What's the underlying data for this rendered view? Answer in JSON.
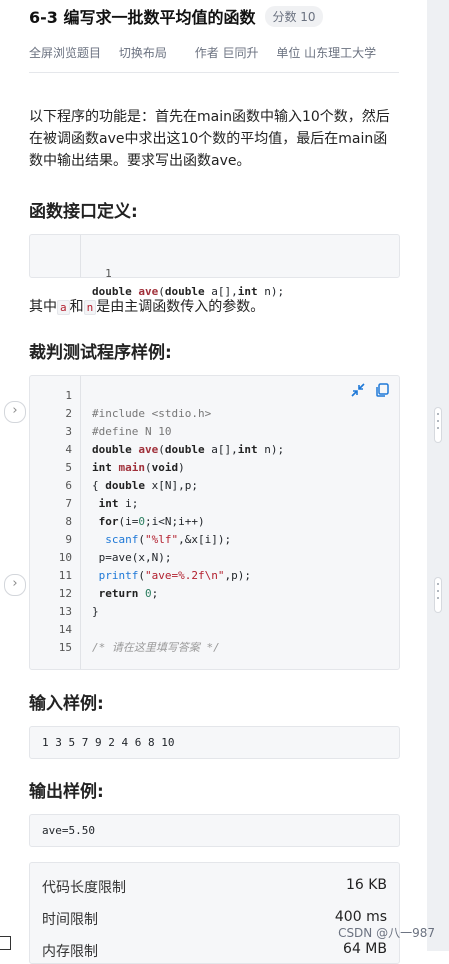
{
  "problem": {
    "title": "6-3 编写求一批数平均值的函数",
    "score_badge": "分数 10"
  },
  "meta": {
    "fullscreen": "全屏浏览题目",
    "switch_layout": "切换布局",
    "author": "作者 巨同升",
    "unit": "单位 山东理工大学"
  },
  "description": "以下程序的功能是：首先在main函数中输入10个数，然后在被调函数ave中求出这10个数的平均值，最后在main函数中输出结果。要求写出函数ave。",
  "interface_section": {
    "heading": "函数接口定义:",
    "line_no": "1"
  },
  "note": {
    "prefix": "其中",
    "param_a": "a",
    "and": "和",
    "param_n": "n",
    "suffix": "是由主调函数传入的参数。"
  },
  "test_section": {
    "heading": "裁判测试程序样例:",
    "line_numbers": [
      "1",
      "2",
      "3",
      "4",
      "5",
      "6",
      "7",
      "8",
      "9",
      "10",
      "11",
      "12",
      "13",
      "14",
      "15"
    ]
  },
  "input_sample": {
    "heading": "输入样例:",
    "value": "1 3 5 7 9 2 4 6 8 10"
  },
  "output_sample": {
    "heading": "输出样例:",
    "value": "ave=5.50"
  },
  "limits": [
    {
      "label": "代码长度限制",
      "value": "16 KB"
    },
    {
      "label": "时间限制",
      "value": "400 ms"
    },
    {
      "label": "内存限制",
      "value": "64 MB"
    }
  ],
  "watermark": "CSDN @八一987",
  "icons": {
    "collapse": "collapse-icon",
    "copy": "copy-icon",
    "side_arrow": "chevron-right-icon"
  },
  "colors": {
    "accent": "#1e78d7",
    "keyword_fn": "#a0303a",
    "string": "#b3202f"
  }
}
